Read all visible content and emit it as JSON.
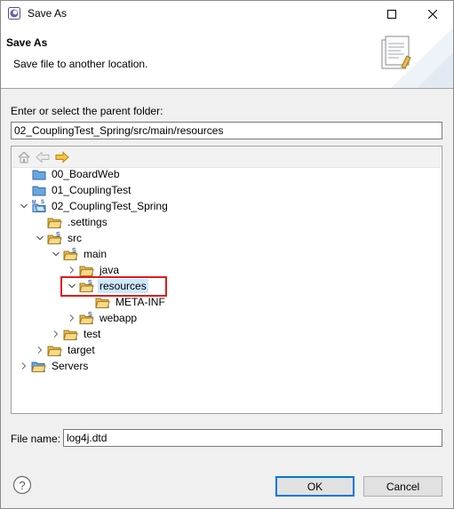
{
  "window": {
    "title": "Save As"
  },
  "banner": {
    "title": "Save As",
    "description": "Save file to another location."
  },
  "parent_folder": {
    "label": "Enter or select the parent folder:",
    "value": "02_CouplingTest_Spring/src/main/resources"
  },
  "tree": {
    "items": [
      {
        "label": "00_BoardWeb",
        "icon": "project-closed-icon"
      },
      {
        "label": "01_CouplingTest",
        "icon": "project-closed-icon"
      },
      {
        "label": "02_CouplingTest_Spring",
        "icon": "spring-project-icon"
      },
      {
        "label": ".settings",
        "icon": "folder-icon"
      },
      {
        "label": "src",
        "icon": "source-folder-icon"
      },
      {
        "label": "main",
        "icon": "source-folder-icon"
      },
      {
        "label": "java",
        "icon": "folder-icon"
      },
      {
        "label": "resources",
        "icon": "source-folder-icon",
        "selected": true
      },
      {
        "label": "META-INF",
        "icon": "folder-icon"
      },
      {
        "label": "webapp",
        "icon": "source-folder-icon"
      },
      {
        "label": "test",
        "icon": "folder-icon"
      },
      {
        "label": "target",
        "icon": "folder-icon"
      },
      {
        "label": "Servers",
        "icon": "folder-open-icon"
      }
    ]
  },
  "file_name": {
    "label": "File name:",
    "value": "log4j.dtd"
  },
  "buttons": {
    "ok": "OK",
    "cancel": "Cancel"
  },
  "colors": {
    "selection": "#cce8ff",
    "highlight": "#e01b1b",
    "folder": "#e8b94a",
    "focus": "#0078d7"
  }
}
